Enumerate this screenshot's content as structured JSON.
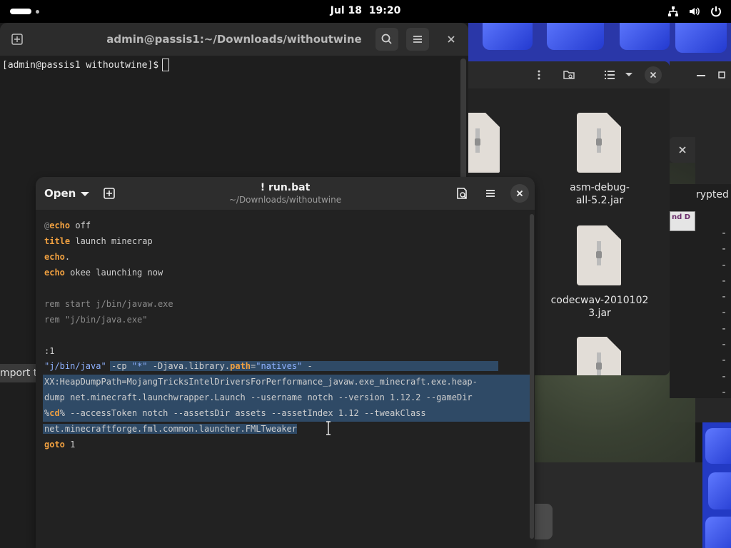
{
  "top_bar": {
    "date": "Jul 18",
    "time": "19:20"
  },
  "terminal": {
    "title": "admin@passis1:~/Downloads/withoutwine",
    "prompt": "[admin@passis1 withoutwine]$"
  },
  "editor": {
    "open_label": "Open",
    "title": "! run.bat",
    "subtitle": "~/Downloads/withoutwine",
    "code_lines": [
      "@echo off",
      "title launch minecrap",
      "echo.",
      "echo okee launching now",
      "",
      "rem start j/bin/javaw.exe",
      "rem \"j/bin/java.exe\"",
      "",
      ":1",
      "\"j/bin/java\" -cp \"*\" -Djava.library.path=\"natives\" -",
      "XX:HeapDumpPath=MojangTricksIntelDriversForPerformance_javaw.exe_minecraft.exe.heap-",
      "dump net.minecraft.launchwrapper.Launch --username notch --version 1.12.2 --gameDir",
      "%cd% --accessToken notch --assetsDir assets --assetIndex 1.12 --tweakClass",
      "net.minecraftforge.fml.common.launcher.FMLTweaker",
      "goto 1"
    ],
    "syntax_colors": {
      "keyword": "#f0a040",
      "string": "#8fb2ff",
      "comment": "#8b8b8b",
      "selection": "#2f4a66"
    }
  },
  "file_manager": {
    "files": [
      {
        "name": "asm-debug-all-5.2.jar",
        "line1": "asm-debug-",
        "line2": "all-5.2.jar"
      },
      {
        "name": "codecwav-20101023.jar",
        "line1": "codecwav-2010102",
        "line2": "3.jar"
      }
    ]
  },
  "other_windows": {
    "crypt_text": "rypted",
    "import_text": "mport t"
  }
}
